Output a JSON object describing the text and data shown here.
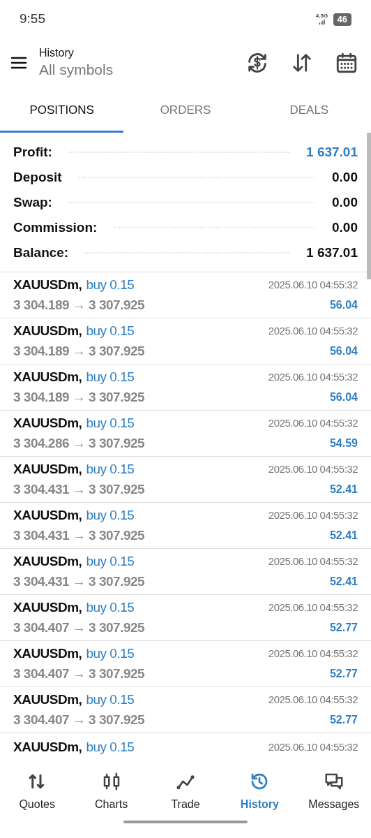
{
  "status_bar": {
    "time": "9:55",
    "network": "4.5G",
    "battery": "46"
  },
  "header": {
    "title": "History",
    "subtitle": "All symbols"
  },
  "tabs": [
    {
      "label": "POSITIONS",
      "selected": true
    },
    {
      "label": "ORDERS",
      "selected": false
    },
    {
      "label": "DEALS",
      "selected": false
    }
  ],
  "summary": [
    {
      "label": "Profit:",
      "value": "1 637.01",
      "highlight": true
    },
    {
      "label": "Deposit",
      "value": "0.00",
      "highlight": false
    },
    {
      "label": "Swap:",
      "value": "0.00",
      "highlight": false
    },
    {
      "label": "Commission:",
      "value": "0.00",
      "highlight": false
    },
    {
      "label": "Balance:",
      "value": "1 637.01",
      "highlight": false
    }
  ],
  "positions": [
    {
      "symbol": "XAUUSDm,",
      "side": "buy 0.15",
      "prices": "3 304.189 → 3 307.925",
      "time": "2025.06.10 04:55:32",
      "profit": "56.04"
    },
    {
      "symbol": "XAUUSDm,",
      "side": "buy 0.15",
      "prices": "3 304.189 → 3 307.925",
      "time": "2025.06.10 04:55:32",
      "profit": "56.04"
    },
    {
      "symbol": "XAUUSDm,",
      "side": "buy 0.15",
      "prices": "3 304.189 → 3 307.925",
      "time": "2025.06.10 04:55:32",
      "profit": "56.04"
    },
    {
      "symbol": "XAUUSDm,",
      "side": "buy 0.15",
      "prices": "3 304.286 → 3 307.925",
      "time": "2025.06.10 04:55:32",
      "profit": "54.59"
    },
    {
      "symbol": "XAUUSDm,",
      "side": "buy 0.15",
      "prices": "3 304.431 → 3 307.925",
      "time": "2025.06.10 04:55:32",
      "profit": "52.41"
    },
    {
      "symbol": "XAUUSDm,",
      "side": "buy 0.15",
      "prices": "3 304.431 → 3 307.925",
      "time": "2025.06.10 04:55:32",
      "profit": "52.41"
    },
    {
      "symbol": "XAUUSDm,",
      "side": "buy 0.15",
      "prices": "3 304.431 → 3 307.925",
      "time": "2025.06.10 04:55:32",
      "profit": "52.41"
    },
    {
      "symbol": "XAUUSDm,",
      "side": "buy 0.15",
      "prices": "3 304.407 → 3 307.925",
      "time": "2025.06.10 04:55:32",
      "profit": "52.77"
    },
    {
      "symbol": "XAUUSDm,",
      "side": "buy 0.15",
      "prices": "3 304.407 → 3 307.925",
      "time": "2025.06.10 04:55:32",
      "profit": "52.77"
    },
    {
      "symbol": "XAUUSDm,",
      "side": "buy 0.15",
      "prices": "3 304.407 → 3 307.925",
      "time": "2025.06.10 04:55:32",
      "profit": "52.77"
    },
    {
      "symbol": "XAUUSDm,",
      "side": "buy 0.15",
      "time": "2025.06.10 04:55:32"
    }
  ],
  "nav": [
    {
      "label": "Quotes",
      "kind": "quotes",
      "selected": false
    },
    {
      "label": "Charts",
      "kind": "charts",
      "selected": false
    },
    {
      "label": "Trade",
      "kind": "trade",
      "selected": false
    },
    {
      "label": "History",
      "kind": "history",
      "selected": true
    },
    {
      "label": "Messages",
      "kind": "messages",
      "selected": false
    }
  ]
}
